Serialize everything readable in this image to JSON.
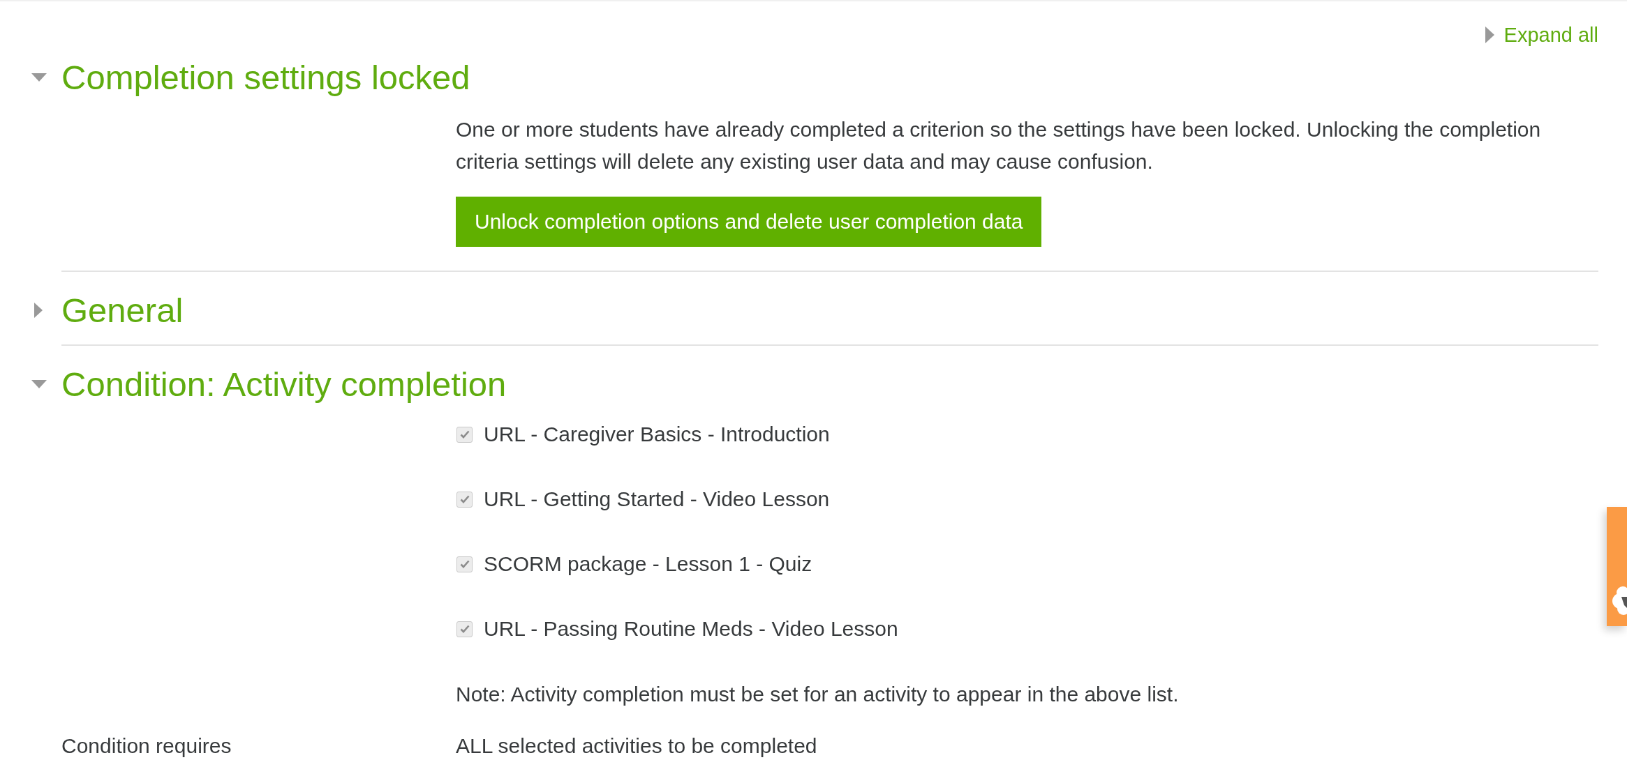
{
  "toolbar": {
    "expand_all": "Expand all"
  },
  "sections": [
    {
      "title": "Completion settings locked",
      "expanded": true,
      "message": "One or more students have already completed a criterion so the settings have been locked. Unlocking the completion criteria settings will delete any existing user data and may cause confusion.",
      "button": "Unlock completion options and delete user completion data"
    },
    {
      "title": "General",
      "expanded": false
    },
    {
      "title": "Condition: Activity completion",
      "expanded": true,
      "activities": [
        {
          "label": "URL - Caregiver Basics - Introduction",
          "checked": true,
          "disabled": true
        },
        {
          "label": "URL - Getting Started - Video Lesson",
          "checked": true,
          "disabled": true
        },
        {
          "label": "SCORM package - Lesson 1 - Quiz",
          "checked": true,
          "disabled": true
        },
        {
          "label": "URL - Passing Routine Meds - Video Lesson",
          "checked": true,
          "disabled": true
        }
      ],
      "note": "Note: Activity completion must be set for an activity to appear in the above list.",
      "fields": [
        {
          "label": "Condition requires",
          "value": "ALL selected activities to be completed"
        }
      ]
    }
  ]
}
